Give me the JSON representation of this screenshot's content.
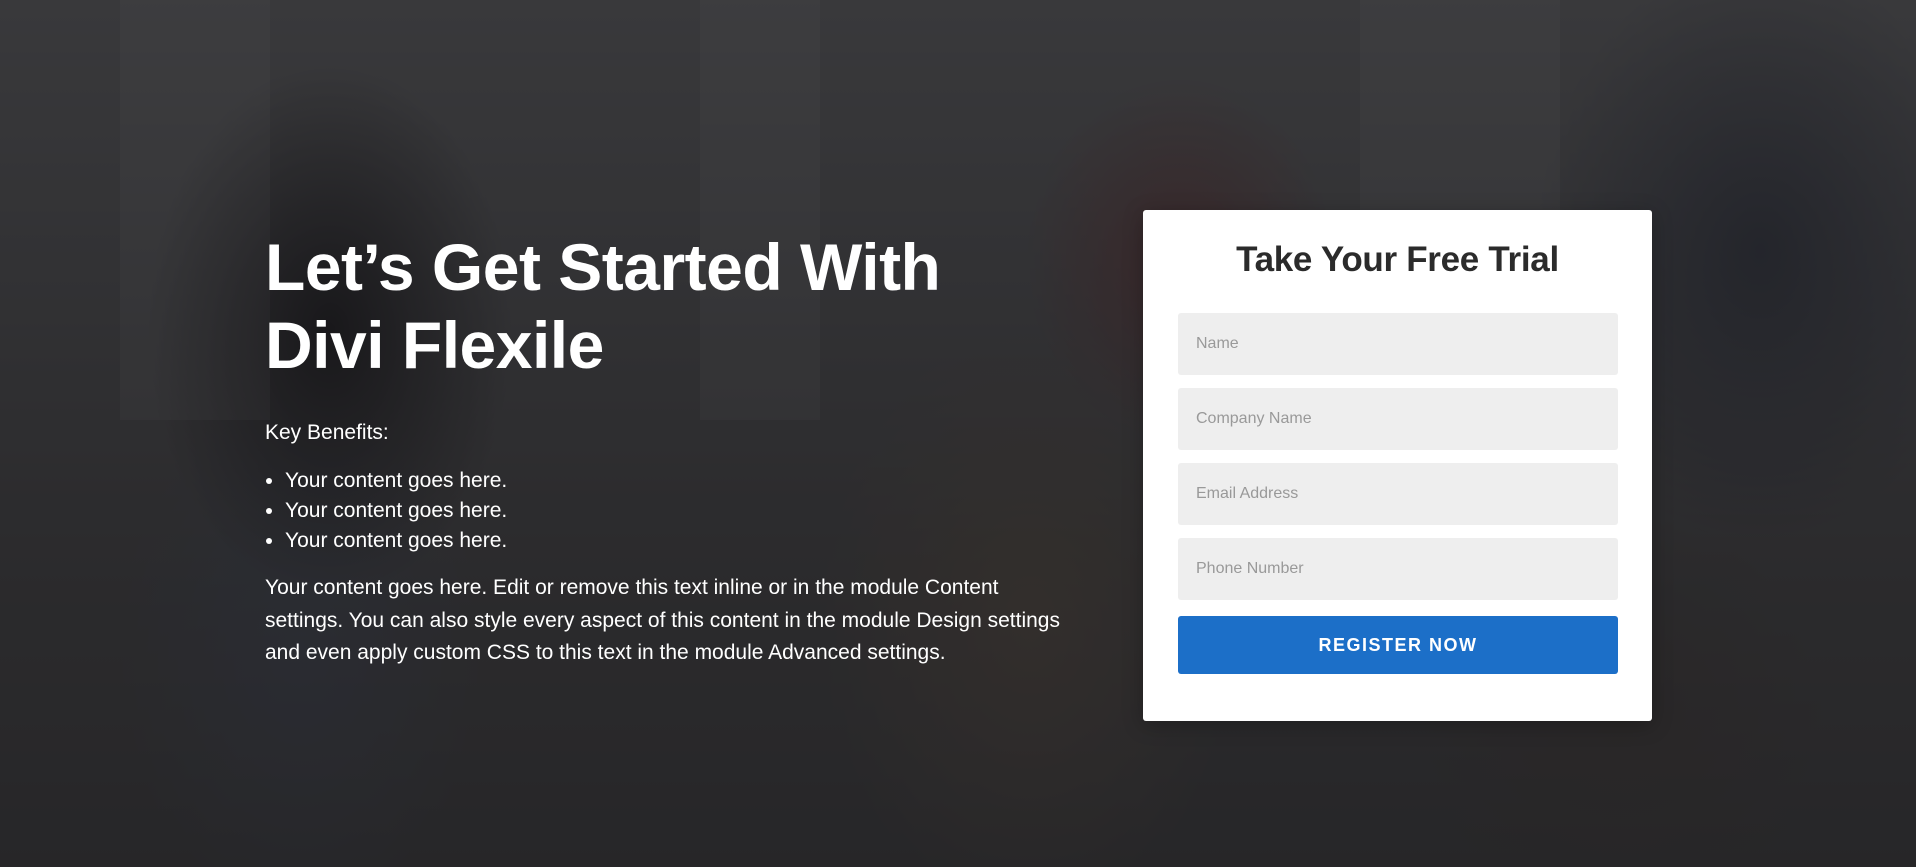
{
  "hero": {
    "headline_line1": "Let’s Get Started With",
    "headline_line2": "Divi Flexile",
    "benefits_label": "Key Benefits:",
    "benefits": [
      "Your content goes here.",
      "Your content goes here.",
      "Your content goes here."
    ],
    "paragraph": "Your content goes here. Edit or remove this text inline or in the module Content settings. You can also style every aspect of this content in the module Design settings and even apply custom CSS to this text in the module Advanced settings."
  },
  "form": {
    "title": "Take Your Free Trial",
    "fields": {
      "name_placeholder": "Name",
      "company_placeholder": "Company Name",
      "email_placeholder": "Email Address",
      "phone_placeholder": "Phone Number"
    },
    "submit_label": "REGISTER NOW"
  },
  "colors": {
    "accent": "#1c6fc8",
    "field_bg": "#eeeeee",
    "overlay": "#19191c"
  }
}
